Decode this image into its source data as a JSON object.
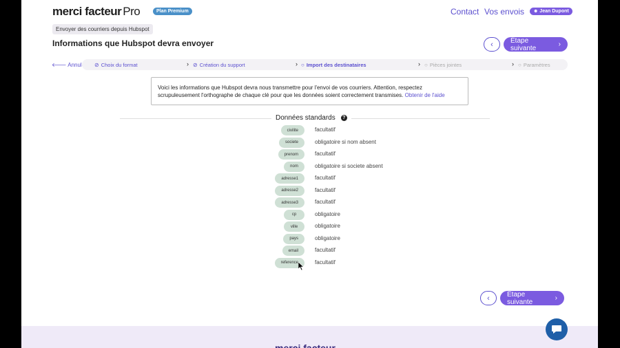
{
  "header": {
    "logo_main": "merci facteur",
    "logo_suffix": "Pro",
    "plan_badge": "Plan Premium",
    "nav": [
      "Contact",
      "Vos envois"
    ],
    "user": "☻ Jean Dupont"
  },
  "breadcrumb": "Envoyer des courriers depuis Hubspot",
  "page_title": "Informations que Hubspot devra envoyer",
  "buttons": {
    "prev": "‹",
    "next": "Étape suivante",
    "next_icon": "›",
    "cancel": "🡐 Annuler"
  },
  "stepper": {
    "steps": [
      {
        "label": "Choix du format",
        "state": "done"
      },
      {
        "label": "Création du support",
        "state": "done"
      },
      {
        "label": "Import des destinataires",
        "state": "current"
      },
      {
        "label": "Pièces jointes",
        "state": "todo"
      },
      {
        "label": "Paramètres",
        "state": "todo"
      }
    ],
    "arrow": "›"
  },
  "info": {
    "text": "Voici les informations que Hubspot devra nous transmettre pour l'envoi de vos courriers. Attention, respectez scrupuleusement l'orthographe de chaque clé pour que les données soient correctement transmises.",
    "help_link": "Obtenir de l'aide"
  },
  "section": {
    "title": "Données standards",
    "help_icon": "?"
  },
  "fields": [
    {
      "key": "civilite",
      "requirement": "facultatif"
    },
    {
      "key": "societe",
      "requirement": "obligatoire si nom absent"
    },
    {
      "key": "prenom",
      "requirement": "facultatif"
    },
    {
      "key": "nom",
      "requirement": "obligatoire si societe absent"
    },
    {
      "key": "adresse1",
      "requirement": "facultatif"
    },
    {
      "key": "adresse2",
      "requirement": "facultatif"
    },
    {
      "key": "adresse3",
      "requirement": "facultatif"
    },
    {
      "key": "cp",
      "requirement": "obligatoire"
    },
    {
      "key": "ville",
      "requirement": "obligatoire"
    },
    {
      "key": "pays",
      "requirement": "obligatoire"
    },
    {
      "key": "email",
      "requirement": "facultatif"
    },
    {
      "key": "reference",
      "requirement": "facultatif"
    }
  ],
  "footer": {
    "logo": "merci facteur"
  },
  "colors": {
    "accent": "#7b5be0",
    "link": "#5b4fcf",
    "key_bg": "#cfe0d5",
    "chat": "#1f5fa8"
  }
}
